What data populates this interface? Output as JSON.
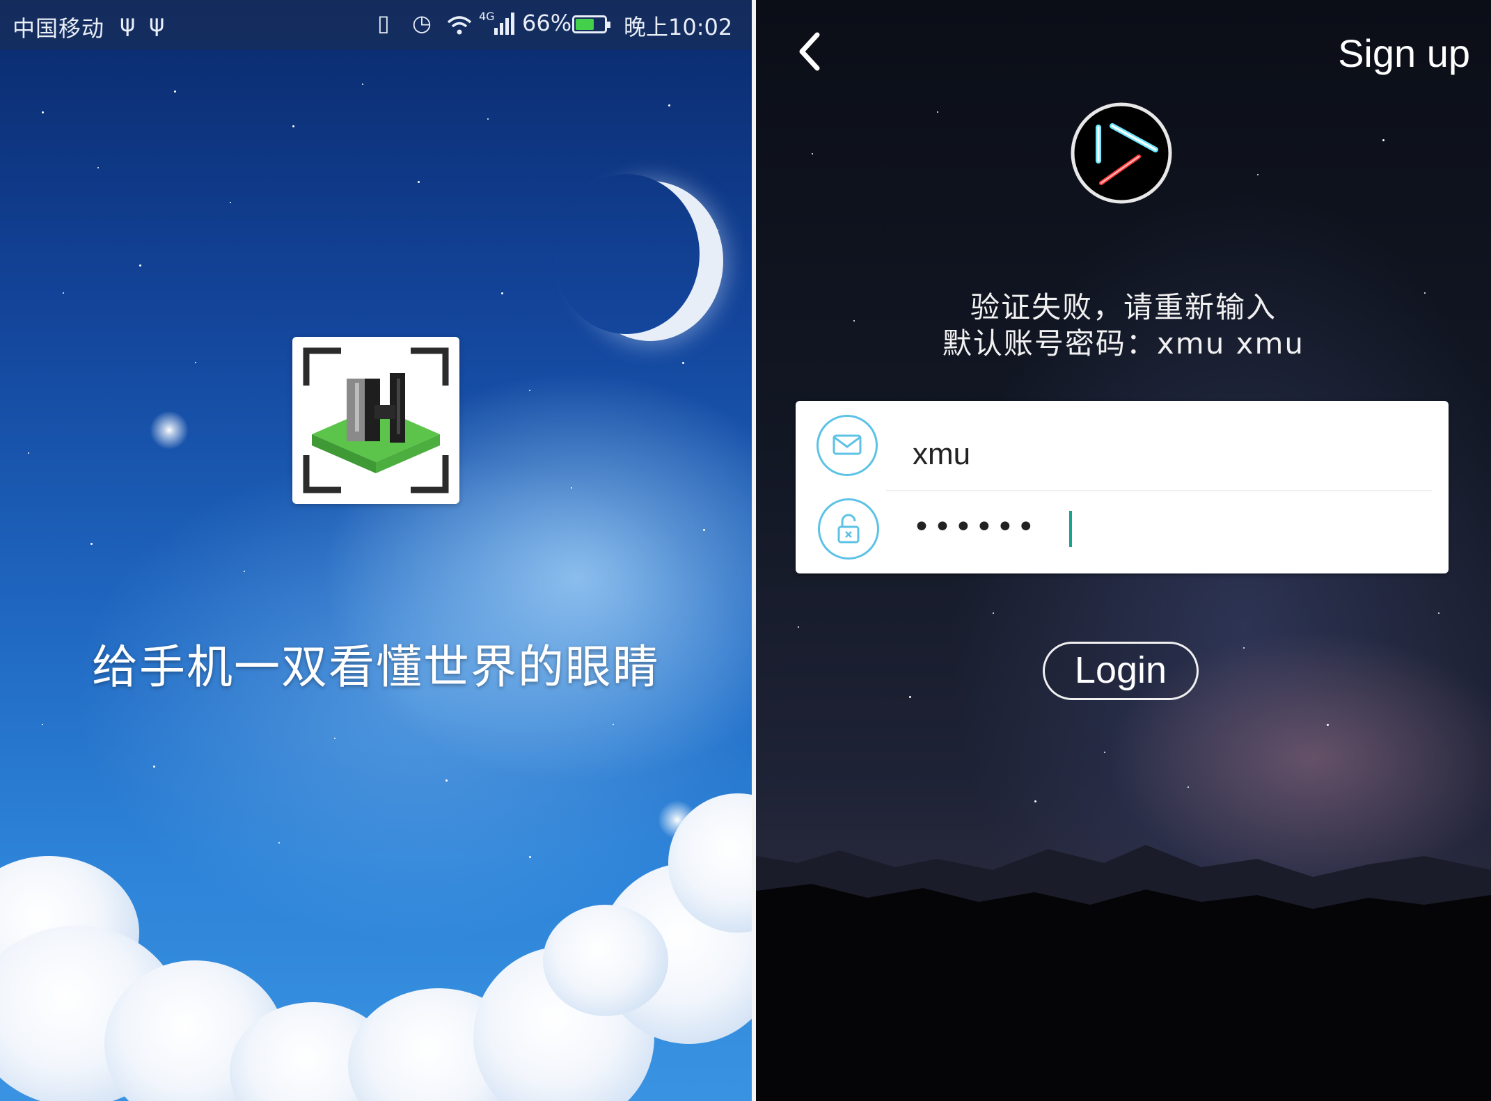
{
  "splash": {
    "status_bar": {
      "carrier": "中国移动",
      "usb_icons": [
        "ψ",
        "ψ"
      ],
      "network": "4G",
      "battery_percent": "66%",
      "battery_level": 0.66,
      "time": "晚上10:02"
    },
    "slogan": "给手机一双看懂世界的眼睛",
    "logo_icon": "pixel-h-building-icon"
  },
  "login": {
    "header": {
      "back_icon": "chevron-left-icon",
      "signup_label": "Sign up"
    },
    "app_logo_icon": "lightsaber-logo-icon",
    "message_line1": "验证失败，请重新输入",
    "message_line2": "默认账号密码：xmu xmu",
    "username": {
      "icon": "envelope-icon",
      "value": "xmu"
    },
    "password": {
      "icon": "lock-icon",
      "masked_value": "••••••"
    },
    "login_button": "Login",
    "colors": {
      "field_icon_accent": "#5cc2e6",
      "caret": "#1aa38c"
    }
  }
}
